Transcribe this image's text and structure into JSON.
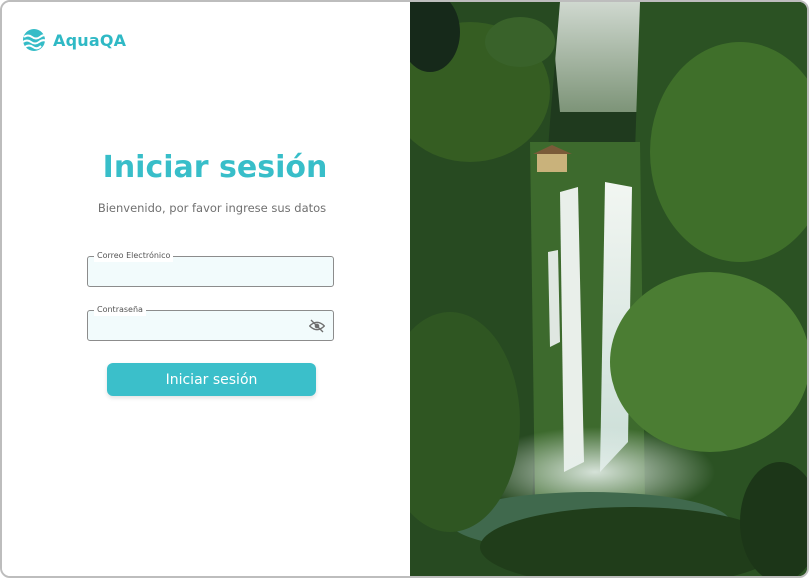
{
  "brand": {
    "name": "AquaQA",
    "logo_icon": "wave-icon",
    "color": "#2fb9c5"
  },
  "login": {
    "title": "Iniciar sesión",
    "subtitle": "Bienvenido, por favor ingrese sus datos",
    "email_label": "Correo Electrónico",
    "email_value": "",
    "password_label": "Contraseña",
    "password_value": "",
    "toggle_icon": "eye-off-icon",
    "submit_label": "Iniciar sesión"
  },
  "theme": {
    "accent": "#3bbfca",
    "field_background": "#f2fbfc"
  },
  "hero": {
    "image_icon": "waterfall-photo"
  }
}
